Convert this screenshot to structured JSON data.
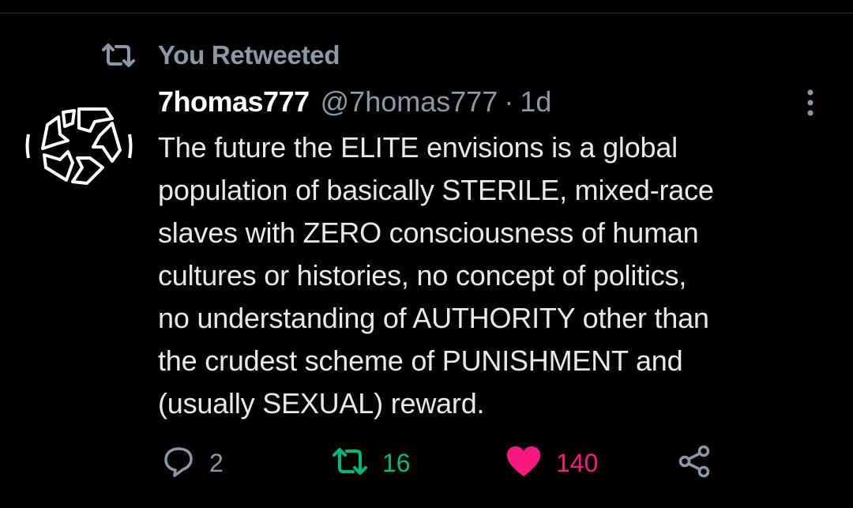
{
  "social_context": {
    "label": "You Retweeted",
    "icon": "retweet-icon"
  },
  "tweet": {
    "avatar_icon": "triskelion-logo-avatar",
    "display_name": "7homas777",
    "handle": "@7homas777",
    "separator": "·",
    "timestamp": "1d",
    "more_icon": "more-vertical-icon",
    "text_lines": [
      "The future the ELITE envisions is a global",
      "population of basically STERILE, mixed-race",
      "slaves with ZERO consciousness of human",
      "cultures or histories, no concept of politics,",
      "no understanding of AUTHORITY other than",
      "the crudest scheme of PUNISHMENT and",
      "(usually SEXUAL) reward."
    ]
  },
  "actions": {
    "reply": {
      "icon": "reply-icon",
      "count": "2"
    },
    "retweet": {
      "icon": "retweet-icon",
      "count": "16",
      "active": true
    },
    "like": {
      "icon": "heart-icon",
      "count": "140",
      "active": true
    },
    "share": {
      "icon": "share-icon"
    }
  },
  "colors": {
    "background": "#000000",
    "text": "#e7e9ea",
    "secondary": "#8b98a5",
    "retweet_active": "#00ba7c",
    "like_active": "#f91880"
  }
}
